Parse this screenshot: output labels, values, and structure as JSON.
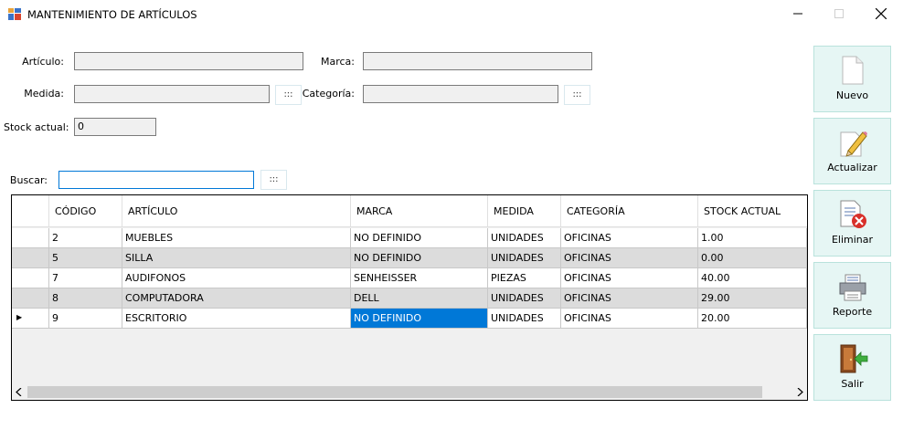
{
  "window": {
    "title": "MANTENIMIENTO DE ARTÍCULOS",
    "controls": [
      "minimize",
      "maximize",
      "close"
    ]
  },
  "form": {
    "articulo": {
      "label": "Artículo:",
      "value": ""
    },
    "marca": {
      "label": "Marca:",
      "value": ""
    },
    "medida": {
      "label": "Medida:",
      "value": "",
      "button": ":::"
    },
    "categoria": {
      "label": "Categoría:",
      "value": "",
      "button": ":::"
    },
    "stock_actual": {
      "label": "Stock actual:",
      "value": "0"
    }
  },
  "search": {
    "label": "Buscar:",
    "value": "",
    "button": ":::"
  },
  "table": {
    "columns": [
      "CÓDIGO",
      "ARTÍCULO",
      "MARCA",
      "MEDIDA",
      "CATEGORÍA",
      "STOCK ACTUAL"
    ],
    "rows": [
      [
        "2",
        "MUEBLES",
        "NO DEFINIDO",
        "UNIDADES",
        "OFICINAS",
        "1.00"
      ],
      [
        "5",
        "SILLA",
        "NO DEFINIDO",
        "UNIDADES",
        "OFICINAS",
        "0.00"
      ],
      [
        "7",
        "AUDIFONOS",
        "SENHEISSER",
        "PIEZAS",
        "OFICINAS",
        "40.00"
      ],
      [
        "8",
        "COMPUTADORA",
        "DELL",
        "UNIDADES",
        "OFICINAS",
        "29.00"
      ],
      [
        "9",
        "ESCRITORIO",
        "NO DEFINIDO",
        "UNIDADES",
        "OFICINAS",
        "20.00"
      ]
    ],
    "current_row_indicator": "▶",
    "selected_cell": "NO DEFINIDO"
  },
  "actions": {
    "nuevo": {
      "label": "Nuevo",
      "icon": "new-document-icon"
    },
    "actualizar": {
      "label": "Actualizar",
      "icon": "edit-pencil-icon"
    },
    "eliminar": {
      "label": "Eliminar",
      "icon": "delete-document-icon"
    },
    "reporte": {
      "label": "Reporte",
      "icon": "printer-icon"
    },
    "salir": {
      "label": "Salir",
      "icon": "exit-door-icon"
    }
  },
  "colors": {
    "selection": "#0078d7",
    "alt_row": "#dcdcdc",
    "side_button_bg": "#e6f6f4"
  }
}
